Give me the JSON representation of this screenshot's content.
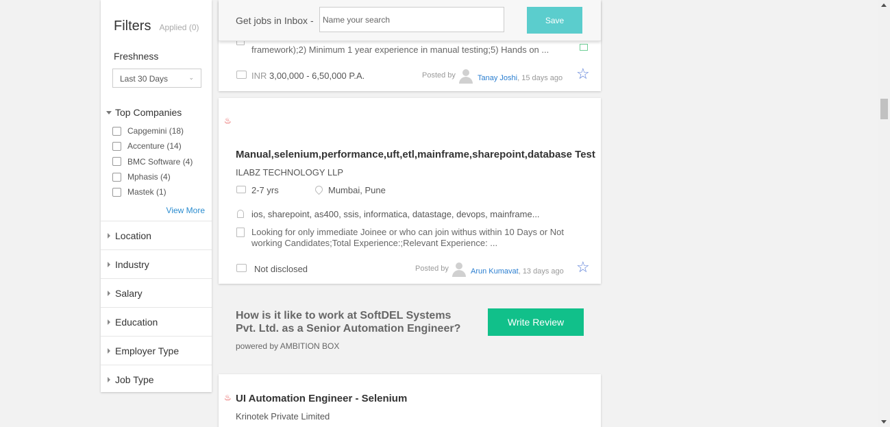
{
  "sidebar": {
    "title": "Filters",
    "applied": "Applied (0)",
    "freshness": {
      "label": "Freshness",
      "selected": "Last 30 Days"
    },
    "top_companies": {
      "label": "Top Companies",
      "items": [
        {
          "label": "Capgemini (18)"
        },
        {
          "label": "Accenture (14)"
        },
        {
          "label": "BMC Software (4)"
        },
        {
          "label": "Mphasis (4)"
        },
        {
          "label": "Mastek (1)"
        }
      ],
      "view_more": "View More"
    },
    "sections": [
      "Location",
      "Industry",
      "Salary",
      "Education",
      "Employer Type",
      "Job Type"
    ]
  },
  "inbox": {
    "label": "Get jobs in Inbox -",
    "placeholder": "Name your search",
    "save_label": "Save"
  },
  "jobs": [
    {
      "desc_line1": "framework);2) Minimum 1 year experience in manual testing;5) Hands on ...",
      "salary_prefix": "INR",
      "salary": "3,00,000 - 6,50,000 P.A.",
      "posted_by_label": "Posted by",
      "poster": "Tanay Joshi",
      "posted_ago": ", 15 days ago"
    },
    {
      "title_pre": "Manual,",
      "title_bold": "selenium",
      "title_post": ",performance,uft,etl,mainframe,sharepoint,database Test",
      "company": "ILABZ TECHNOLOGY LLP",
      "experience": "2-7 yrs",
      "location": "Mumbai, Pune",
      "skills": "ios, sharepoint, as400, ssis, informatica, datastage, devops, mainframe...",
      "desc_line1": "Looking for only immediate Joinee or who can join withus within 10 Days or Not",
      "desc_line2": "working Candidates;Total Experience:;Relevant Experience: ...",
      "salary": "Not disclosed",
      "posted_by_label": "Posted by",
      "poster": "Arun Kumavat",
      "posted_ago": ", 13 days ago"
    },
    {
      "title_pre": "UI Automation Engineer - ",
      "title_bold": "Selenium",
      "company": "Krinotek Private Limited"
    }
  ],
  "review": {
    "question": "How is it like to work at SoftDEL Systems Pvt. Ltd. as a Senior Automation Engineer?",
    "powered_by": "powered by AMBITION BOX",
    "button_label": "Write Review"
  }
}
